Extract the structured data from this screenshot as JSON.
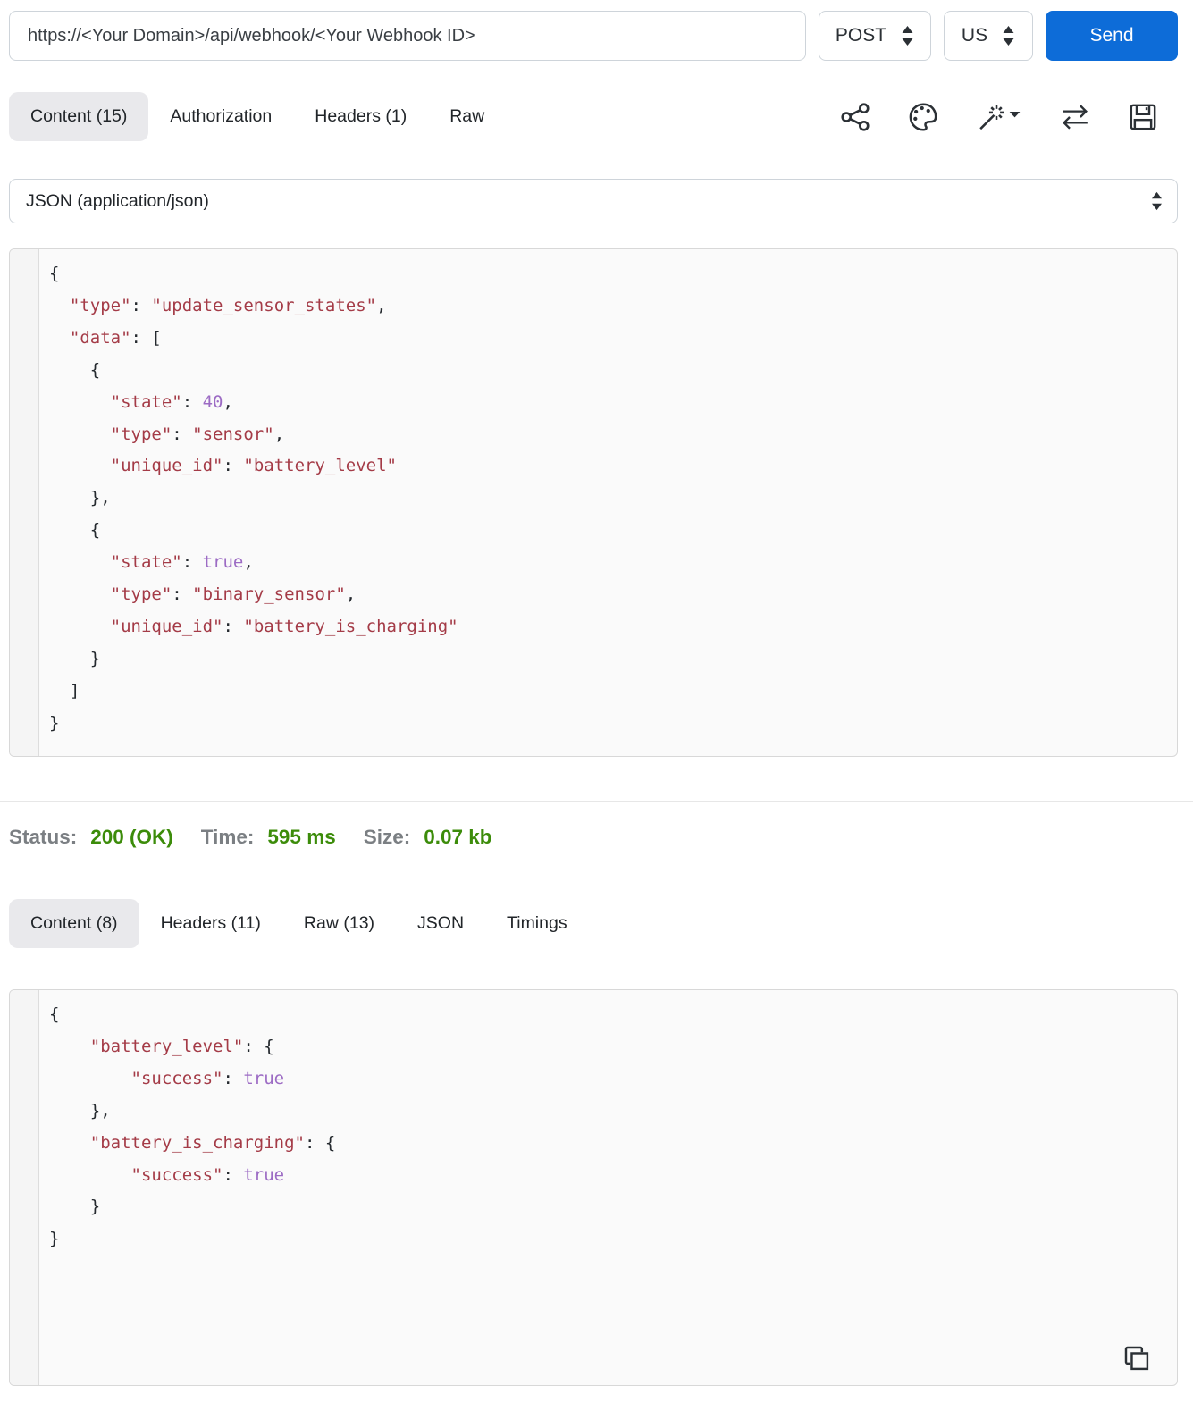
{
  "request_bar": {
    "url": "https://<Your Domain>/api/webhook/<Your Webhook ID>",
    "method": "POST",
    "region": "US",
    "send_label": "Send"
  },
  "request_tabs": [
    {
      "label": "Content (15)",
      "active": true
    },
    {
      "label": "Authorization",
      "active": false
    },
    {
      "label": "Headers (1)",
      "active": false
    },
    {
      "label": "Raw",
      "active": false
    }
  ],
  "toolbar_icons": [
    "share-icon",
    "palette-icon",
    "magic-wand-icon",
    "swap-arrows-icon",
    "save-icon"
  ],
  "content_type": {
    "selected": "JSON (application/json)"
  },
  "request_body": {
    "language": "json",
    "lines": [
      [
        [
          "p",
          "{"
        ]
      ],
      [
        [
          "p",
          "  "
        ],
        [
          "k",
          "\"type\""
        ],
        [
          "p",
          ": "
        ],
        [
          "s",
          "\"update_sensor_states\""
        ],
        [
          "p",
          ","
        ]
      ],
      [
        [
          "p",
          "  "
        ],
        [
          "k",
          "\"data\""
        ],
        [
          "p",
          ": ["
        ]
      ],
      [
        [
          "p",
          "    {"
        ]
      ],
      [
        [
          "p",
          "      "
        ],
        [
          "k",
          "\"state\""
        ],
        [
          "p",
          ": "
        ],
        [
          "n",
          "40"
        ],
        [
          "p",
          ","
        ]
      ],
      [
        [
          "p",
          "      "
        ],
        [
          "k",
          "\"type\""
        ],
        [
          "p",
          ": "
        ],
        [
          "s",
          "\"sensor\""
        ],
        [
          "p",
          ","
        ]
      ],
      [
        [
          "p",
          "      "
        ],
        [
          "k",
          "\"unique_id\""
        ],
        [
          "p",
          ": "
        ],
        [
          "s",
          "\"battery_level\""
        ]
      ],
      [
        [
          "p",
          "    },"
        ]
      ],
      [
        [
          "p",
          "    {"
        ]
      ],
      [
        [
          "p",
          "      "
        ],
        [
          "k",
          "\"state\""
        ],
        [
          "p",
          ": "
        ],
        [
          "n",
          "true"
        ],
        [
          "p",
          ","
        ]
      ],
      [
        [
          "p",
          "      "
        ],
        [
          "k",
          "\"type\""
        ],
        [
          "p",
          ": "
        ],
        [
          "s",
          "\"binary_sensor\""
        ],
        [
          "p",
          ","
        ]
      ],
      [
        [
          "p",
          "      "
        ],
        [
          "k",
          "\"unique_id\""
        ],
        [
          "p",
          ": "
        ],
        [
          "s",
          "\"battery_is_charging\""
        ]
      ],
      [
        [
          "p",
          "    }"
        ]
      ],
      [
        [
          "p",
          "  ]"
        ]
      ],
      [
        [
          "p",
          "}"
        ]
      ]
    ]
  },
  "status_bar": {
    "status_label": "Status:",
    "status_value": "200 (OK)",
    "time_label": "Time:",
    "time_value": "595 ms",
    "size_label": "Size:",
    "size_value": "0.07 kb"
  },
  "response_tabs": [
    {
      "label": "Content (8)",
      "active": true
    },
    {
      "label": "Headers (11)",
      "active": false
    },
    {
      "label": "Raw (13)",
      "active": false
    },
    {
      "label": "JSON",
      "active": false
    },
    {
      "label": "Timings",
      "active": false
    }
  ],
  "response_body": {
    "language": "json",
    "lines": [
      [
        [
          "p",
          "{"
        ]
      ],
      [
        [
          "p",
          "    "
        ],
        [
          "k",
          "\"battery_level\""
        ],
        [
          "p",
          ": {"
        ]
      ],
      [
        [
          "p",
          "        "
        ],
        [
          "k",
          "\"success\""
        ],
        [
          "p",
          ": "
        ],
        [
          "n",
          "true"
        ]
      ],
      [
        [
          "p",
          "    },"
        ]
      ],
      [
        [
          "p",
          "    "
        ],
        [
          "k",
          "\"battery_is_charging\""
        ],
        [
          "p",
          ": {"
        ]
      ],
      [
        [
          "p",
          "        "
        ],
        [
          "k",
          "\"success\""
        ],
        [
          "p",
          ": "
        ],
        [
          "n",
          "true"
        ]
      ],
      [
        [
          "p",
          "    }"
        ]
      ],
      [
        [
          "p",
          "}"
        ]
      ]
    ]
  },
  "colors": {
    "send_button": "#0d6cd8",
    "status_green": "#3c8c0a",
    "label_gray": "#7b7f83",
    "active_tab_bg": "#e9e9ec",
    "code_string": "#a43b47",
    "code_number": "#9c6bc4",
    "code_punctuation": "#24292e",
    "panel_bg": "#fafafa"
  }
}
